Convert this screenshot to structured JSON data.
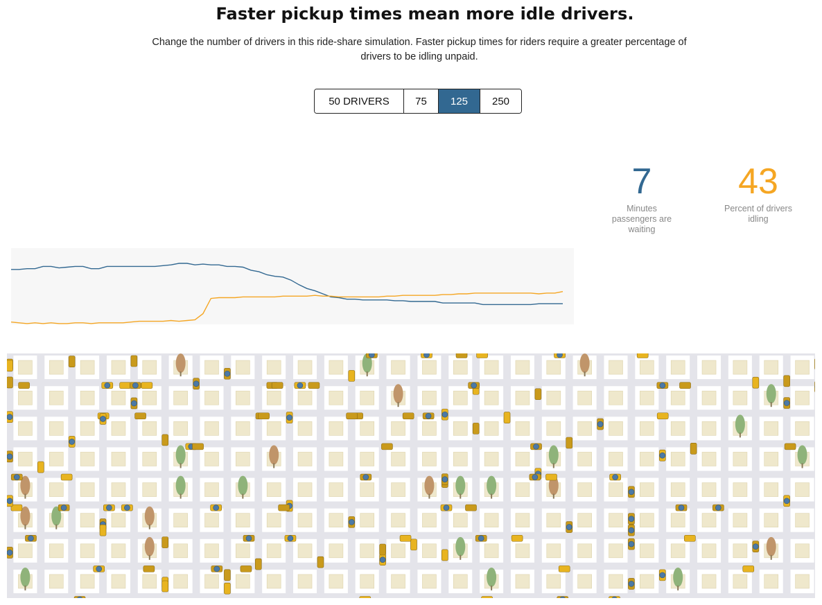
{
  "headline": "Faster pickup times mean more idle drivers.",
  "dek": "Change the number of drivers in this ride-share simulation. Faster pickup times for riders require a greater percentage of drivers to be idling unpaid.",
  "driver_options": [
    {
      "label": "50 DRIVERS",
      "active": false
    },
    {
      "label": "75",
      "active": false
    },
    {
      "label": "125",
      "active": true
    },
    {
      "label": "250",
      "active": false
    }
  ],
  "stats": {
    "wait": {
      "value": "7",
      "caption": "Minutes passengers are waiting"
    },
    "idle": {
      "value": "43",
      "caption": "Percent of drivers idling"
    }
  },
  "colors": {
    "accent_blue": "#326891",
    "accent_orange": "#f5a623",
    "chart_bg": "#f7f7f7",
    "road": "#e4e4ea",
    "block": "#ffffff",
    "lot": "#efe8cc",
    "car": "#e8b420",
    "tree_green": "#8fb37a",
    "tree_brown": "#c0956a"
  },
  "chart_data": {
    "type": "line",
    "grid": false,
    "legend": "none",
    "ylim": [
      0,
      100
    ],
    "series": [
      {
        "color": "#326891",
        "values": [
          28,
          28,
          27,
          27,
          24,
          24,
          26,
          25,
          24,
          24,
          27,
          27,
          24,
          24,
          24,
          24,
          24,
          24,
          24,
          23,
          22,
          20,
          20,
          22,
          21,
          22,
          22,
          24,
          24,
          25,
          29,
          31,
          35,
          37,
          38,
          42,
          48,
          53,
          56,
          60,
          64,
          65,
          67,
          67,
          68,
          68,
          68,
          68,
          69,
          69,
          70,
          70,
          70,
          70,
          72,
          72,
          72,
          72,
          72,
          74,
          74,
          74,
          74,
          74,
          74,
          74,
          73,
          73,
          73,
          73
        ]
      },
      {
        "color": "#f5a623",
        "values": [
          97,
          98,
          99,
          98,
          99,
          98,
          99,
          99,
          98,
          98,
          99,
          98,
          98,
          98,
          98,
          97,
          96,
          96,
          96,
          96,
          95,
          96,
          95,
          94,
          86,
          66,
          65,
          65,
          65,
          64,
          64,
          64,
          64,
          64,
          63,
          63,
          63,
          63,
          62,
          63,
          63,
          64,
          64,
          64,
          64,
          64,
          64,
          63,
          63,
          62,
          62,
          62,
          62,
          62,
          61,
          61,
          60,
          60,
          59,
          59,
          59,
          59,
          59,
          59,
          59,
          59,
          60,
          59,
          59,
          57
        ]
      }
    ]
  },
  "map": {
    "cols": 26,
    "rows": 8,
    "tree_seed": 7,
    "car_count": 125
  }
}
